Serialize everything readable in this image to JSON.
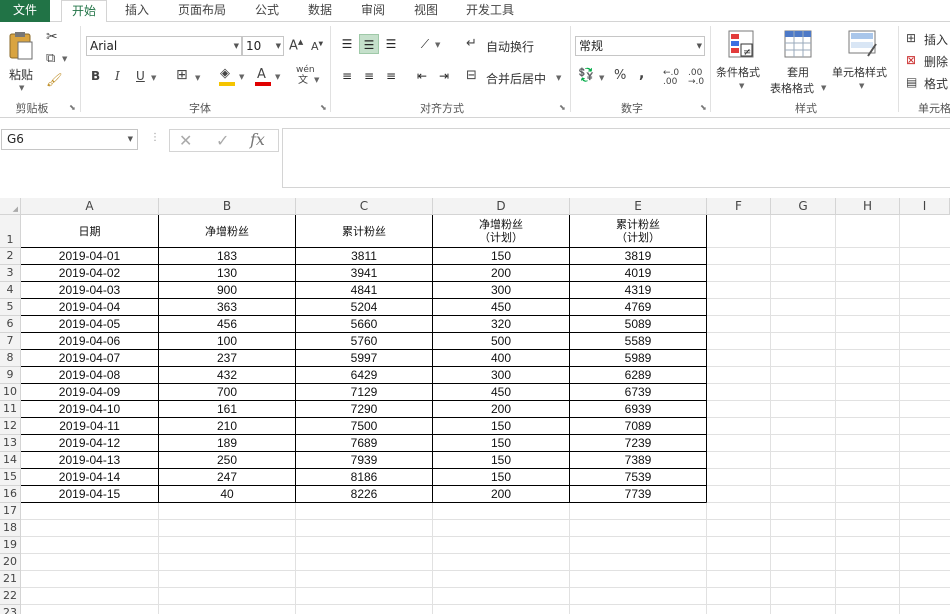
{
  "tabs": [
    "文件",
    "开始",
    "插入",
    "页面布局",
    "公式",
    "数据",
    "审阅",
    "视图",
    "开发工具"
  ],
  "ribbon": {
    "clipboard": {
      "paste": "粘贴",
      "label": "剪贴板"
    },
    "font": {
      "name": "Arial",
      "size": "10",
      "bold": "B",
      "italic": "I",
      "underline": "U",
      "label": "字体",
      "phonetic_top": "wén",
      "phonetic_bottom": "文"
    },
    "align": {
      "wrap": "自动换行",
      "merge": "合并后居中",
      "label": "对齐方式"
    },
    "number": {
      "format": "常规",
      "percent": "%",
      "comma": ",",
      "label": "数字"
    },
    "styles": {
      "conditional": "条件格式",
      "table_1": "套用",
      "table_2": "表格格式",
      "cell_styles": "单元格样式",
      "label": "样式"
    },
    "cells": {
      "insert": "插入",
      "delete": "删除",
      "format": "格式",
      "label": "单元格"
    }
  },
  "formula_bar": {
    "name_box": "G6",
    "fx": "fx",
    "value": ""
  },
  "columns": [
    "A",
    "B",
    "C",
    "D",
    "E",
    "F",
    "G",
    "H",
    "I"
  ],
  "row_numbers": [
    "1",
    "2",
    "3",
    "4",
    "5",
    "6",
    "7",
    "8",
    "9",
    "10",
    "11",
    "12",
    "13",
    "14",
    "15",
    "16",
    "17",
    "18",
    "19",
    "20",
    "21",
    "22",
    "23"
  ],
  "header_row": [
    {
      "l1": "日期",
      "l2": ""
    },
    {
      "l1": "净增粉丝",
      "l2": ""
    },
    {
      "l1": "累计粉丝",
      "l2": ""
    },
    {
      "l1": "净增粉丝",
      "l2": "（计划）"
    },
    {
      "l1": "累计粉丝",
      "l2": "（计划）"
    }
  ],
  "rows": [
    [
      "2019-04-01",
      "183",
      "3811",
      "150",
      "3819"
    ],
    [
      "2019-04-02",
      "130",
      "3941",
      "200",
      "4019"
    ],
    [
      "2019-04-03",
      "900",
      "4841",
      "300",
      "4319"
    ],
    [
      "2019-04-04",
      "363",
      "5204",
      "450",
      "4769"
    ],
    [
      "2019-04-05",
      "456",
      "5660",
      "320",
      "5089"
    ],
    [
      "2019-04-06",
      "100",
      "5760",
      "500",
      "5589"
    ],
    [
      "2019-04-07",
      "237",
      "5997",
      "400",
      "5989"
    ],
    [
      "2019-04-08",
      "432",
      "6429",
      "300",
      "6289"
    ],
    [
      "2019-04-09",
      "700",
      "7129",
      "450",
      "6739"
    ],
    [
      "2019-04-10",
      "161",
      "7290",
      "200",
      "6939"
    ],
    [
      "2019-04-11",
      "210",
      "7500",
      "150",
      "7089"
    ],
    [
      "2019-04-12",
      "189",
      "7689",
      "150",
      "7239"
    ],
    [
      "2019-04-13",
      "250",
      "7939",
      "150",
      "7389"
    ],
    [
      "2019-04-14",
      "247",
      "8186",
      "150",
      "7539"
    ],
    [
      "2019-04-15",
      "40",
      "8226",
      "200",
      "7739"
    ]
  ],
  "colors": {
    "accent": "#217346",
    "grid": "#e1e1e1",
    "header_bg": "#f3f3f3",
    "selected_align": "#c5e0cb"
  }
}
